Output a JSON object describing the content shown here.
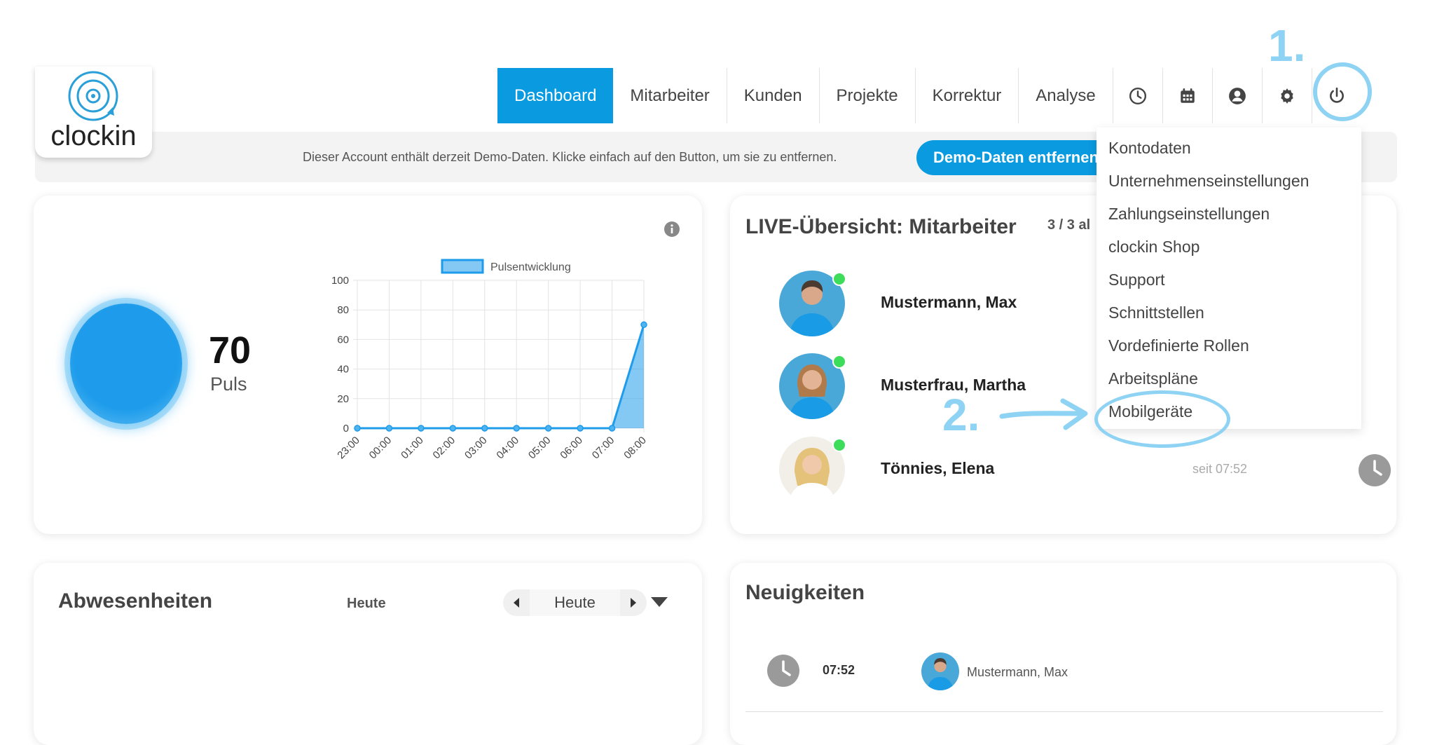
{
  "app": {
    "logo_text": "clockin"
  },
  "nav": {
    "items": [
      "Dashboard",
      "Mitarbeiter",
      "Kunden",
      "Projekte",
      "Korrektur",
      "Analyse"
    ],
    "active": "Dashboard",
    "icons": [
      "clock-icon",
      "calendar-icon",
      "user-icon",
      "gear-icon",
      "power-icon"
    ]
  },
  "annotations": {
    "step1": "1.",
    "step2": "2.",
    "highlight_color": "#8fd3f4"
  },
  "banner": {
    "text": "Dieser Account enthält derzeit Demo-Daten. Klicke einfach auf den Button, um sie zu entfernen.",
    "button": "Demo-Daten entfernen"
  },
  "pulse": {
    "value": "70",
    "label": "Puls"
  },
  "chart_data": {
    "type": "area",
    "legend": "Pulsentwicklung",
    "categories": [
      "23:00",
      "00:00",
      "01:00",
      "02:00",
      "03:00",
      "04:00",
      "05:00",
      "06:00",
      "07:00",
      "08:00"
    ],
    "values": [
      0,
      0,
      0,
      0,
      0,
      0,
      0,
      0,
      0,
      70
    ],
    "ylim": [
      0,
      100
    ],
    "yticks": [
      "0",
      "20",
      "40",
      "60",
      "80",
      "100"
    ],
    "legend_position": "top",
    "grid": true,
    "color": "#1e9ceb"
  },
  "live": {
    "title": "LIVE-Übersicht: Mitarbeiter",
    "count": "3 / 3 al",
    "employees": [
      {
        "name": "Mustermann, Max",
        "since": ""
      },
      {
        "name": "Musterfrau, Martha",
        "since": ""
      },
      {
        "name": "Tönnies, Elena",
        "since": "seit 07:52"
      }
    ]
  },
  "settings_menu": {
    "items": [
      "Kontodaten",
      "Unternehmenseinstellungen",
      "Zahlungseinstellungen",
      "clockin Shop",
      "Support",
      "Schnittstellen",
      "Vordefinierte Rollen",
      "Arbeitspläne",
      "Mobilgeräte"
    ]
  },
  "absences": {
    "title": "Abwesenheiten",
    "filter_label": "Heute",
    "date_value": "Heute"
  },
  "news": {
    "title": "Neuigkeiten",
    "entry": {
      "time": "07:52",
      "name": "Mustermann, Max"
    }
  },
  "colors": {
    "primary": "#0a9ae0",
    "online": "#3ddc5a"
  }
}
